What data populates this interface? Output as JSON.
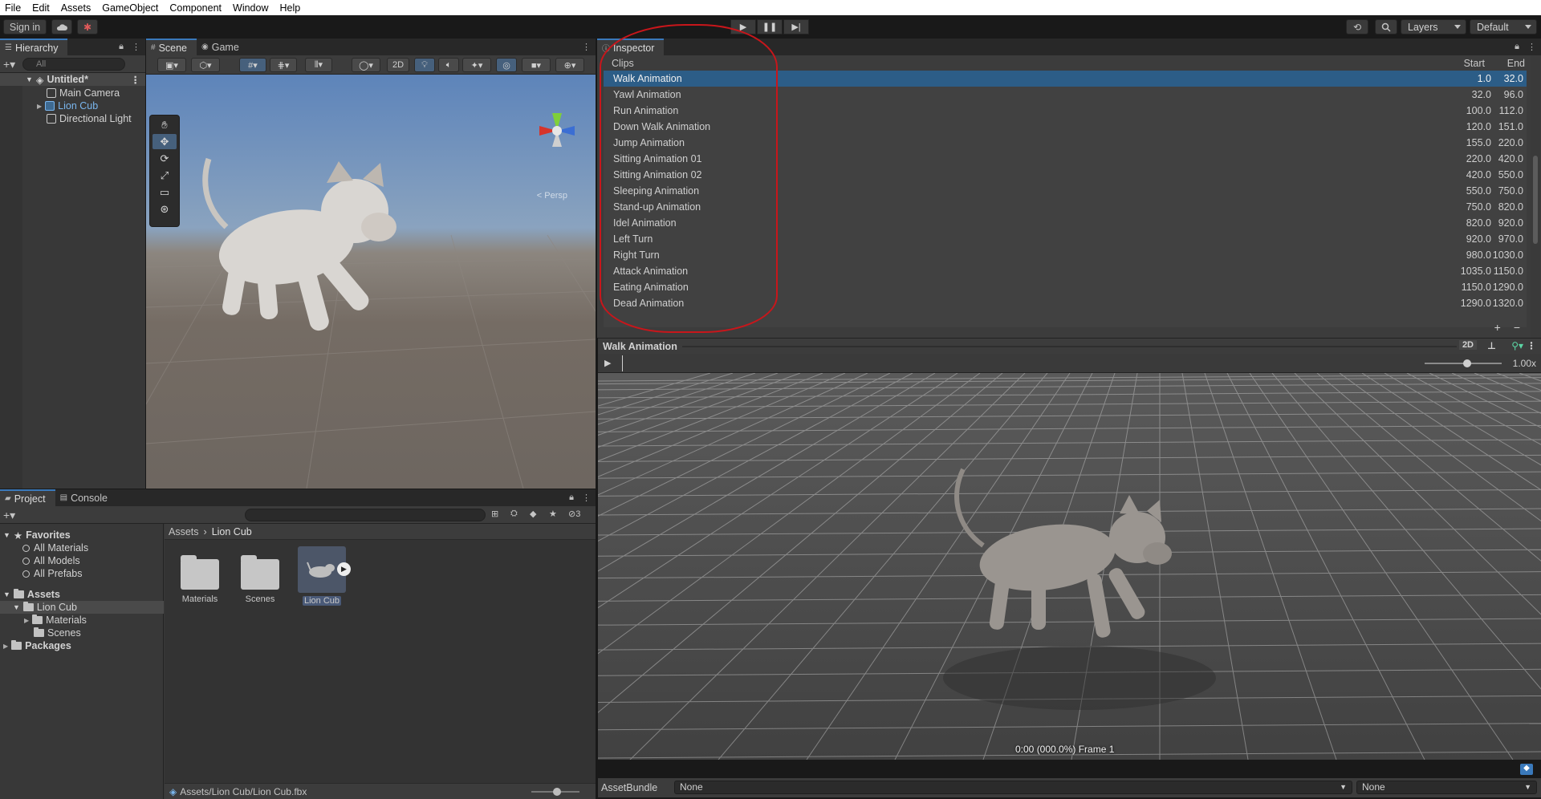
{
  "menu": [
    "File",
    "Edit",
    "Assets",
    "GameObject",
    "Component",
    "Window",
    "Help"
  ],
  "toolbar": {
    "sign_in": "Sign in",
    "layers": "Layers",
    "layout": "Default"
  },
  "hierarchy": {
    "tab": "Hierarchy",
    "search_placeholder": "All",
    "scene": "Untitled*",
    "items": [
      "Main Camera",
      "Lion Cub",
      "Directional Light"
    ]
  },
  "scene": {
    "tabs": [
      "Scene",
      "Game"
    ],
    "mode_2d": "2D",
    "persp_label": "Persp"
  },
  "project": {
    "tabs": [
      "Project",
      "Console"
    ],
    "hidden_count": "3",
    "favorites": {
      "label": "Favorites",
      "items": [
        "All Materials",
        "All Models",
        "All Prefabs"
      ]
    },
    "assets": {
      "label": "Assets",
      "items": [
        "Lion Cub",
        "Materials",
        "Scenes"
      ]
    },
    "packages": "Packages",
    "breadcrumb": [
      "Assets",
      "Lion Cub"
    ],
    "grid": [
      "Materials",
      "Scenes",
      "Lion Cub"
    ],
    "status_path": "Assets/Lion Cub/Lion Cub.fbx"
  },
  "inspector": {
    "tab": "Inspector",
    "clips_label": "Clips",
    "col_start": "Start",
    "col_end": "End",
    "clips": [
      {
        "name": "Walk Animation",
        "start": "1.0",
        "end": "32.0"
      },
      {
        "name": "Yawl Animation",
        "start": "32.0",
        "end": "96.0"
      },
      {
        "name": "Run Animation",
        "start": "100.0",
        "end": "112.0"
      },
      {
        "name": "Down Walk Animation",
        "start": "120.0",
        "end": "151.0"
      },
      {
        "name": "Jump Animation",
        "start": "155.0",
        "end": "220.0"
      },
      {
        "name": "Sitting Animation 01",
        "start": "220.0",
        "end": "420.0"
      },
      {
        "name": "Sitting Animation 02",
        "start": "420.0",
        "end": "550.0"
      },
      {
        "name": "Sleeping Animation",
        "start": "550.0",
        "end": "750.0"
      },
      {
        "name": "Stand-up Animation",
        "start": "750.0",
        "end": "820.0"
      },
      {
        "name": "Idel Animation",
        "start": "820.0",
        "end": "920.0"
      },
      {
        "name": "Left Turn",
        "start": "920.0",
        "end": "970.0"
      },
      {
        "name": "Right Turn",
        "start": "980.0",
        "end": "1030.0"
      },
      {
        "name": "Attack Animation",
        "start": "1035.0",
        "end": "1150.0"
      },
      {
        "name": "Eating Animation",
        "start": "1150.0",
        "end": "1290.0"
      },
      {
        "name": "Dead Animation",
        "start": "1290.0",
        "end": "1320.0"
      }
    ]
  },
  "preview": {
    "title": "Walk Animation",
    "mode_2d": "2D",
    "speed": "1.00x",
    "frame_info": "0:00 (000.0%) Frame 1"
  },
  "asset_bundle": {
    "label": "AssetBundle",
    "name": "None",
    "variant": "None"
  },
  "colors": {
    "accent": "#3a79bb",
    "selection": "#2c5d87",
    "annotation": "#c8161b"
  }
}
